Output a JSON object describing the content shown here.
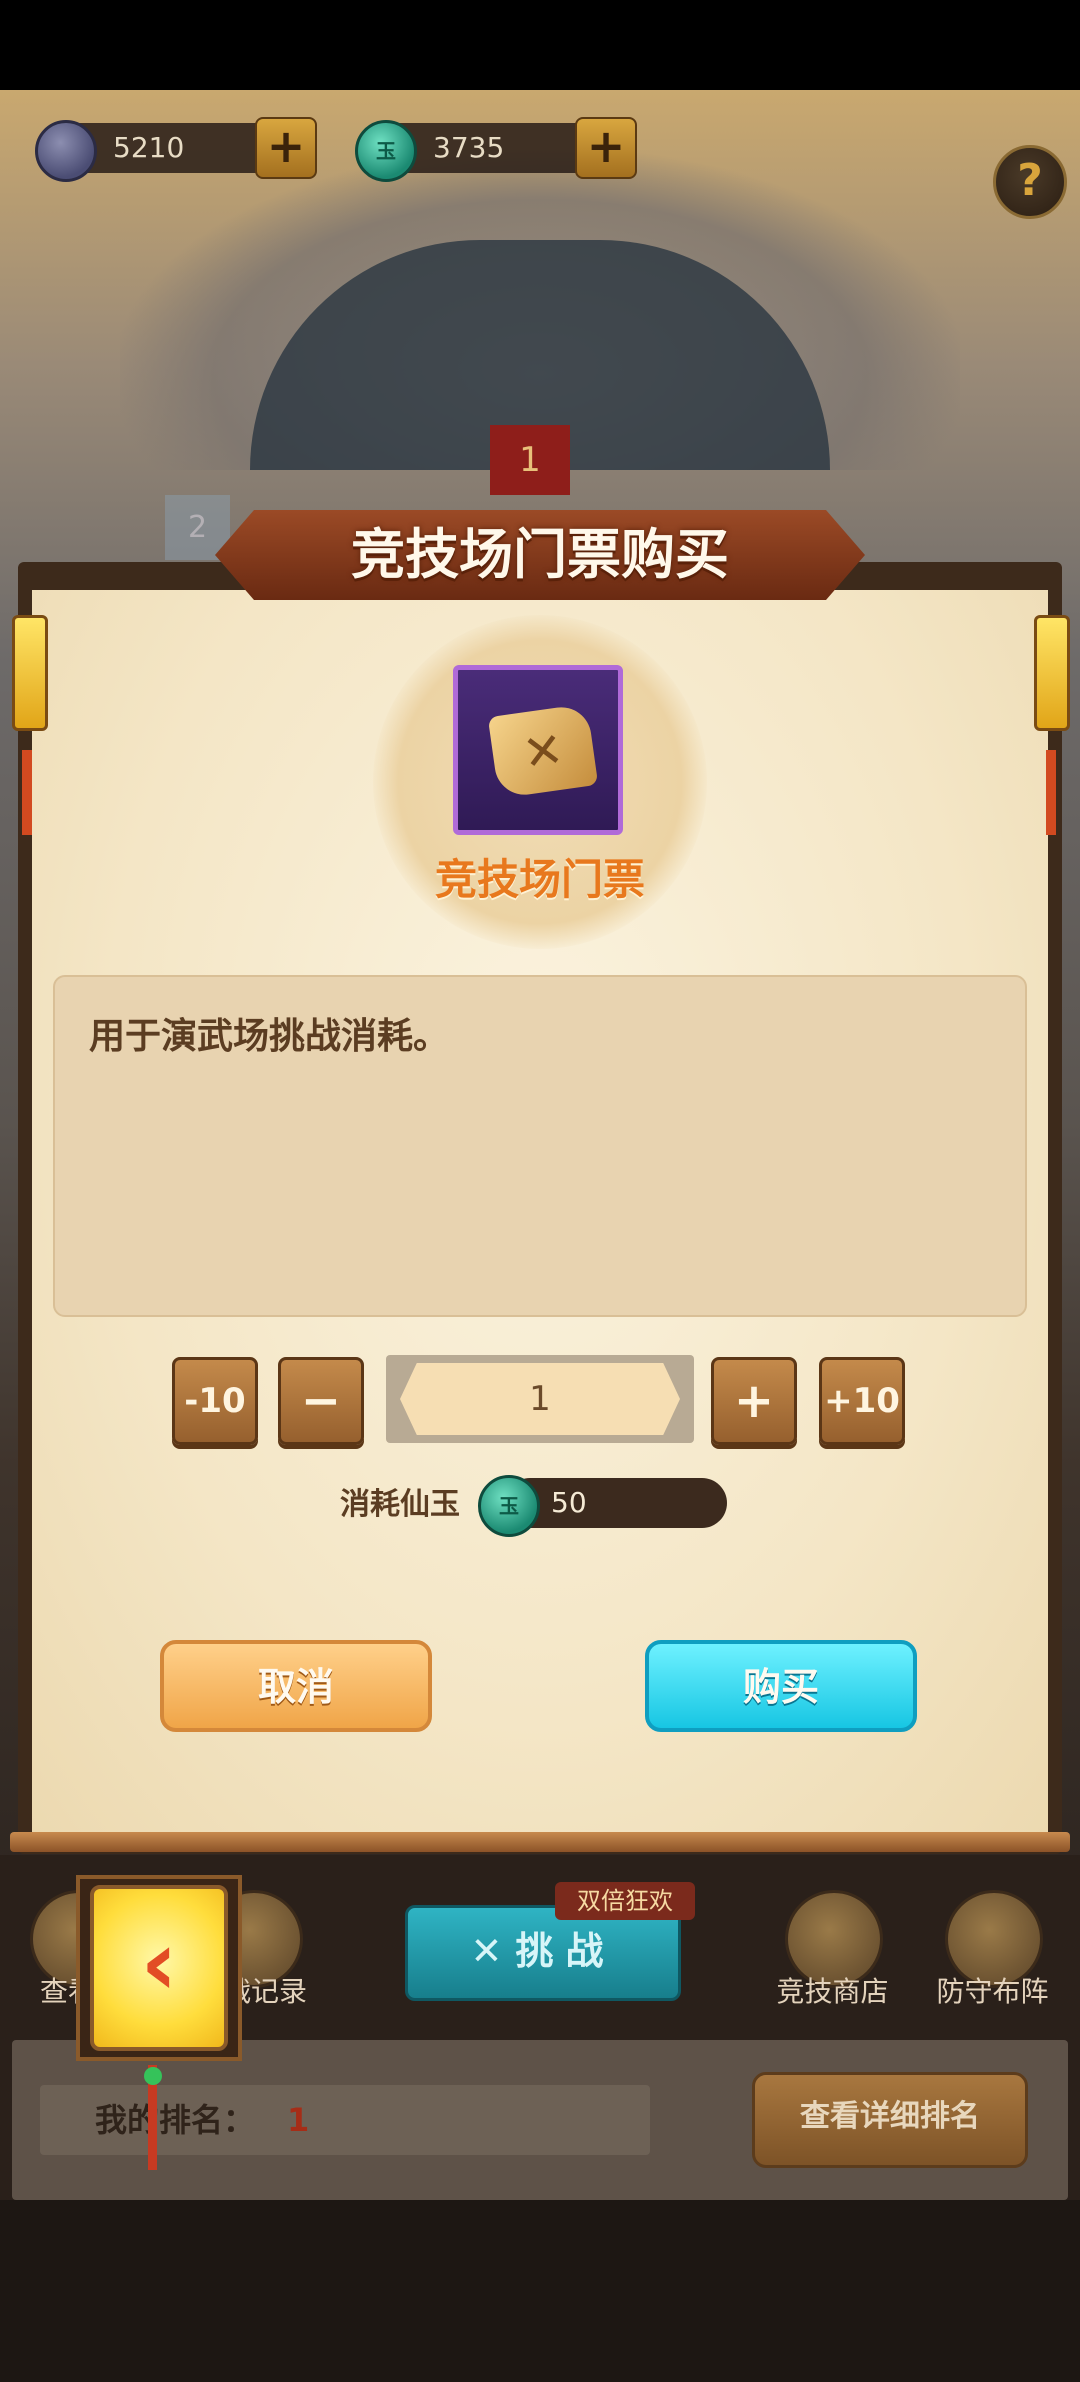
{
  "currency": {
    "gems": "5210",
    "jade": "3735",
    "plus": "+",
    "help": "?"
  },
  "scene": {
    "banner_1": "1",
    "banner_2": "2"
  },
  "modal": {
    "title": "竞技场门票购买",
    "item_name": "竞技场门票",
    "description": "用于演武场挑战消耗。",
    "qty_minus10": "-10",
    "qty_minus": "−",
    "quantity": "1",
    "qty_plus": "+",
    "qty_plus10": "+10",
    "cost_label": "消耗仙玉",
    "cost_value": "50",
    "jade_glyph": "玉",
    "cancel": "取消",
    "buy": "购买"
  },
  "bottom": {
    "nav_left_1": "查看",
    "nav_left_2": "战记录",
    "challenge": "挑战",
    "double_event": "双倍狂欢",
    "nav_shop": "竞技商店",
    "nav_defense": "防守布阵",
    "rank_label": "我的排名：",
    "rank_value": "1",
    "detail_rank": "查看详细排名"
  },
  "icons": [
    "gem-icon",
    "jade-icon",
    "help-icon",
    "map-ticket-icon",
    "back-arrow-icon",
    "shop-icon",
    "defense-icon",
    "swords-icon"
  ],
  "colors": {
    "accent_orange": "#e8781d",
    "buy_cyan": "#17c6e3",
    "cancel_orange": "#f0a548",
    "rank_red": "#a62d17"
  }
}
